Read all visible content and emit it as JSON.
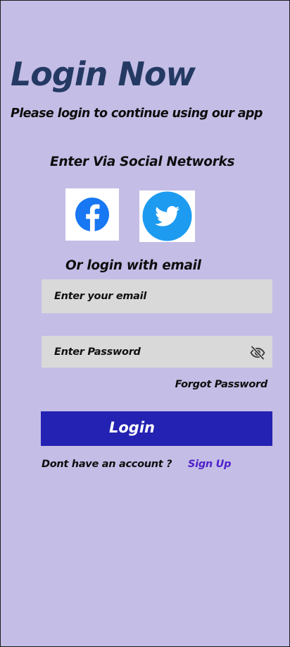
{
  "login": {
    "title": "Login Now",
    "subtitle": "Please login to continue using our app",
    "social_heading": "Enter Via Social Networks",
    "social": [
      {
        "name": "Facebook",
        "icon": "facebook-icon",
        "color": "#1877f2"
      },
      {
        "name": "Twitter",
        "icon": "twitter-icon",
        "color": "#1d9bf0"
      }
    ],
    "or_heading": "Or login with email",
    "email_placeholder": "Enter your email",
    "email_value": "",
    "password_placeholder": "Enter Password",
    "password_value": "",
    "password_visibility_icon": "eye-off-icon",
    "forgot_label": "Forgot Password",
    "login_label": "Login",
    "signup_prompt": "Dont have an account ?",
    "signup_label": "Sign Up"
  },
  "colors": {
    "background": "#c4bde6",
    "title": "#243a63",
    "input_background": "#d9d9d9",
    "primary_button": "#2422b2",
    "link": "#4f21c9"
  }
}
